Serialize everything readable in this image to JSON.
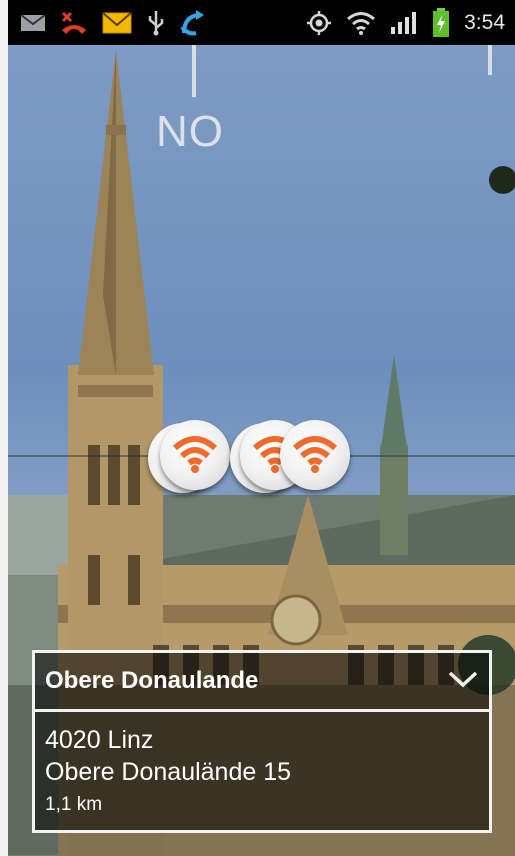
{
  "status_bar": {
    "time": "3:54",
    "icons_left": [
      "gmail-icon",
      "missed-call-icon",
      "email-icon",
      "usb-icon",
      "call-forward-icon"
    ],
    "icons_right": [
      "gps-icon",
      "wifi-icon",
      "signal-icon",
      "battery-charging-icon"
    ]
  },
  "ar_view": {
    "compass_label": "NO",
    "poi_markers": [
      "wifi-hotspot-icon",
      "wifi-hotspot-icon",
      "wifi-hotspot-icon",
      "wifi-hotspot-icon",
      "wifi-hotspot-icon"
    ]
  },
  "info_card": {
    "title": "Obere Donaulande",
    "address_line1": "4020 Linz",
    "address_line2": "Obere Donaulände 15",
    "distance": "1,1 km"
  },
  "colors": {
    "poi_accent": "#ef6a2b",
    "card_border": "#f2f2f2"
  }
}
